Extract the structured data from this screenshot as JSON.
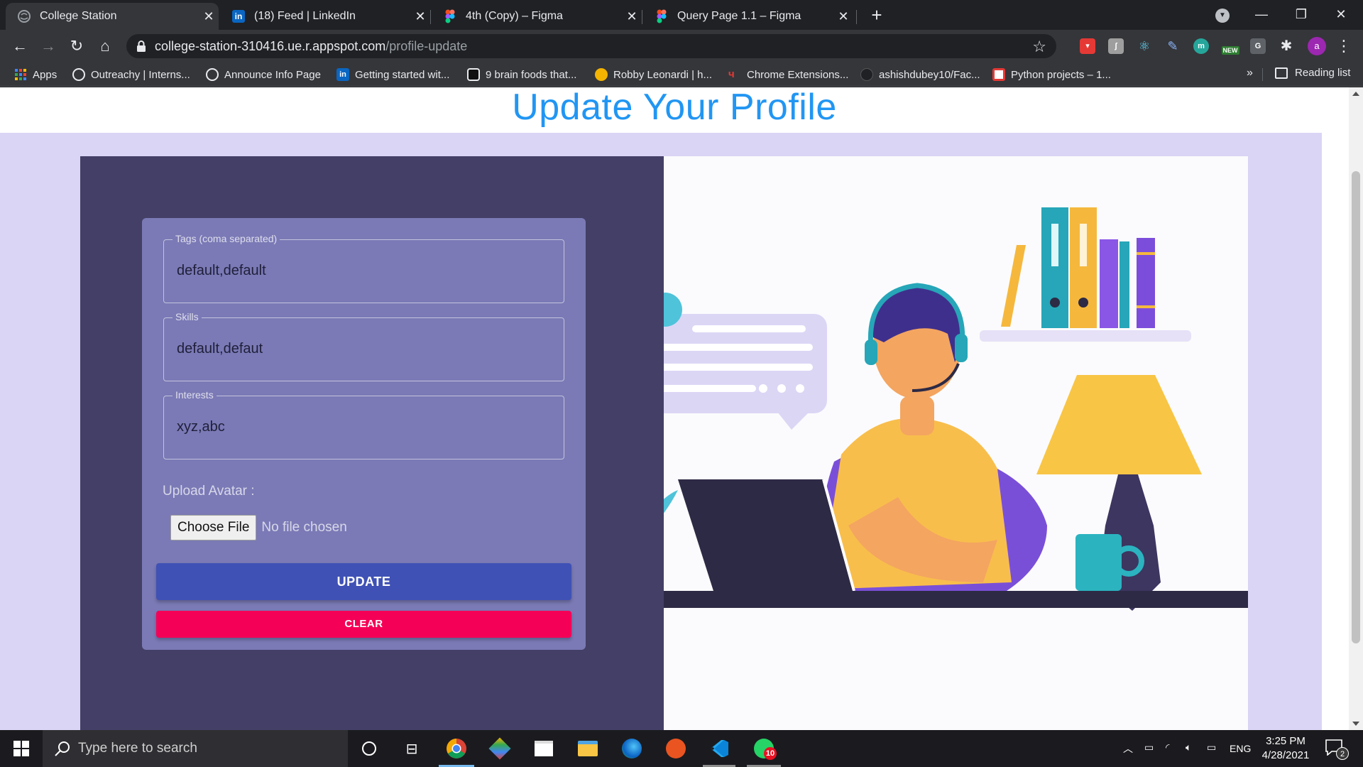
{
  "browser": {
    "tabs": [
      {
        "label": "College Station",
        "active": true,
        "icon": "globe-icon"
      },
      {
        "label": "(18) Feed | LinkedIn",
        "active": false,
        "icon": "linkedin-icon"
      },
      {
        "label": "4th (Copy) – Figma",
        "active": false,
        "icon": "figma-icon"
      },
      {
        "label": "Query Page 1.1 – Figma",
        "active": false,
        "icon": "figma-icon"
      }
    ],
    "new_tab": "+",
    "url_host": "college-station-310416.ue.r.appspot.com",
    "url_path": "/profile-update",
    "profile_initial": "a",
    "extensions": {
      "new_badge": "NEW",
      "g_label": "G",
      "m_label": "m"
    },
    "bookmarks": [
      {
        "label": "Apps",
        "icon": "apps-grid-icon"
      },
      {
        "label": "Outreachy | Interns...",
        "icon": "globe-icon"
      },
      {
        "label": "Announce Info Page",
        "icon": "globe-icon"
      },
      {
        "label": "Getting started wit...",
        "icon": "linkedin-icon"
      },
      {
        "label": "9 brain foods that...",
        "icon": "site-icon"
      },
      {
        "label": "Robby Leonardi | h...",
        "icon": "site-icon"
      },
      {
        "label": "Chrome Extensions...",
        "icon": "site-icon"
      },
      {
        "label": "ashishdubey10/Fac...",
        "icon": "github-icon"
      },
      {
        "label": "Python projects – 1...",
        "icon": "site-icon"
      }
    ],
    "bookmarks_overflow": "»",
    "reading_list": "Reading list"
  },
  "page": {
    "title": "Update Your Profile",
    "form": {
      "fields": [
        {
          "label": "Tags (coma separated)",
          "value": "default,default"
        },
        {
          "label": "Skills",
          "value": "default,defaut"
        },
        {
          "label": "Interests",
          "value": "xyz,abc"
        }
      ],
      "upload_label": "Upload Avatar :",
      "choose_file": "Choose File",
      "no_file": "No file chosen",
      "update": "UPDATE",
      "clear": "CLEAR"
    }
  },
  "taskbar": {
    "search_placeholder": "Type here to search",
    "language": "ENG",
    "time": "3:25 PM",
    "date": "4/28/2021",
    "whatsapp_badge": "10",
    "notifications_count": "2"
  },
  "colors": {
    "title": "#2196f3",
    "update_button": "#3f51b5",
    "clear_button": "#f50057",
    "card": "#7b7ab6",
    "panel": "#433f66",
    "lavender": "#dad4f5"
  }
}
